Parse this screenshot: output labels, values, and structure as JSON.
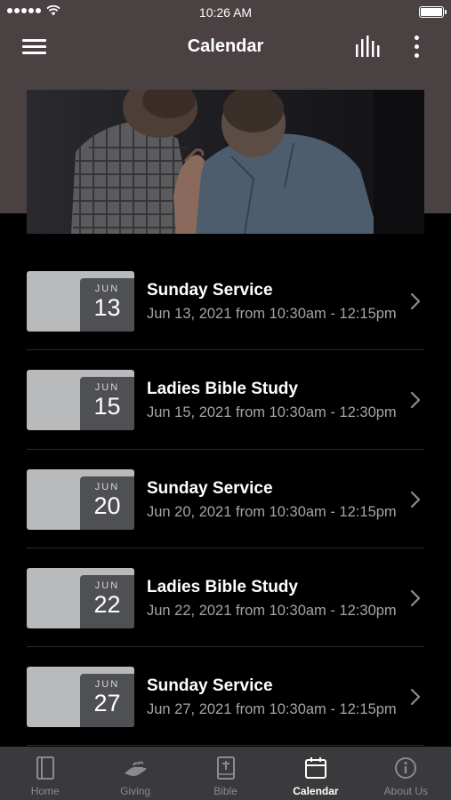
{
  "status_bar": {
    "time": "10:26 AM"
  },
  "header": {
    "title": "Calendar"
  },
  "events": [
    {
      "month": "JUN",
      "day": "13",
      "title": "Sunday Service",
      "subtitle": "Jun 13, 2021 from 10:30am - 12:15pm"
    },
    {
      "month": "JUN",
      "day": "15",
      "title": "Ladies Bible Study",
      "subtitle": "Jun 15, 2021 from 10:30am - 12:30pm"
    },
    {
      "month": "JUN",
      "day": "20",
      "title": "Sunday Service",
      "subtitle": "Jun 20, 2021 from 10:30am - 12:15pm"
    },
    {
      "month": "JUN",
      "day": "22",
      "title": "Ladies Bible Study",
      "subtitle": "Jun 22, 2021 from 10:30am - 12:30pm"
    },
    {
      "month": "JUN",
      "day": "27",
      "title": "Sunday Service",
      "subtitle": "Jun 27, 2021 from 10:30am - 12:15pm"
    }
  ],
  "tab_bar": {
    "tabs": [
      {
        "label": "Home",
        "icon": "book-icon"
      },
      {
        "label": "Giving",
        "icon": "giving-hand-icon"
      },
      {
        "label": "Bible",
        "icon": "bible-cross-icon"
      },
      {
        "label": "Calendar",
        "icon": "calendar-icon",
        "active": true
      },
      {
        "label": "About Us",
        "icon": "info-icon"
      }
    ]
  },
  "colors": {
    "header_bg": "#4a4142",
    "list_bg": "#000000",
    "date_card": "#b9babc",
    "date_badge": "#4f5053",
    "tab_bar_bg": "#3a3a3c",
    "tab_inactive": "#8b8b8e",
    "tab_active": "#ffffff"
  }
}
